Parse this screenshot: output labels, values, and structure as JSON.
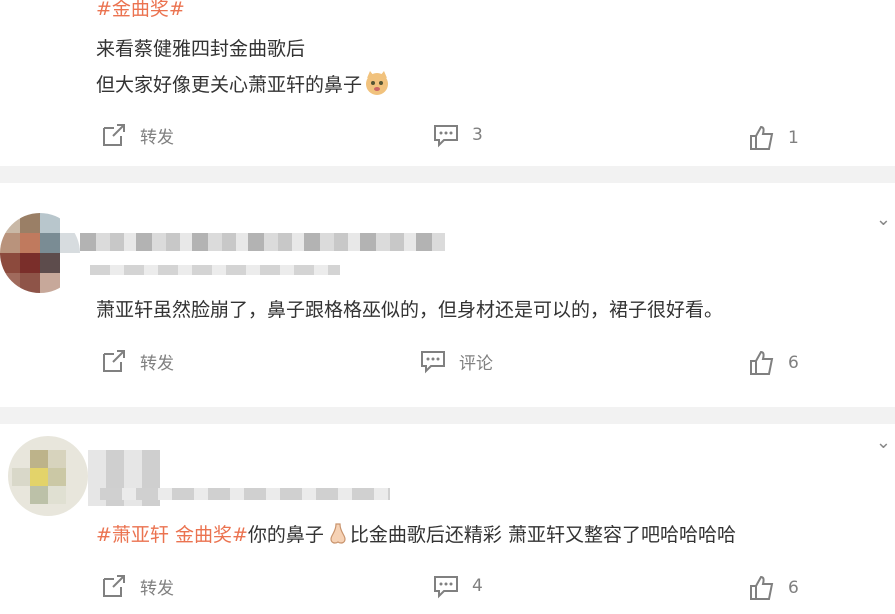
{
  "post1": {
    "hashtag": "#金曲奖#",
    "line1": "来看蔡健雅四封金曲歌后",
    "line2": "但大家好像更关心萧亚轩的鼻子",
    "emoji_icon": "cat-face-emoji",
    "actions": {
      "repost": "转发",
      "comment": "3",
      "like": "1"
    }
  },
  "post2": {
    "text": "萧亚轩虽然脸崩了，鼻子跟格格巫似的，但身材还是可以的，裙子很好看。",
    "actions": {
      "repost": "转发",
      "comment": "评论",
      "like": "6"
    }
  },
  "post3": {
    "tag1": "#萧亚轩 金曲奖#",
    "text_a": "你的鼻子",
    "emoji_icon": "nose-emoji",
    "text_b": "比金曲歌后还精彩 萧亚轩又整容了吧哈哈哈哈",
    "actions": {
      "repost": "转发",
      "comment": "4",
      "like": "6"
    }
  },
  "colors": {
    "accent": "#eb7350",
    "muted": "#808080",
    "separator": "#f2f2f2"
  }
}
